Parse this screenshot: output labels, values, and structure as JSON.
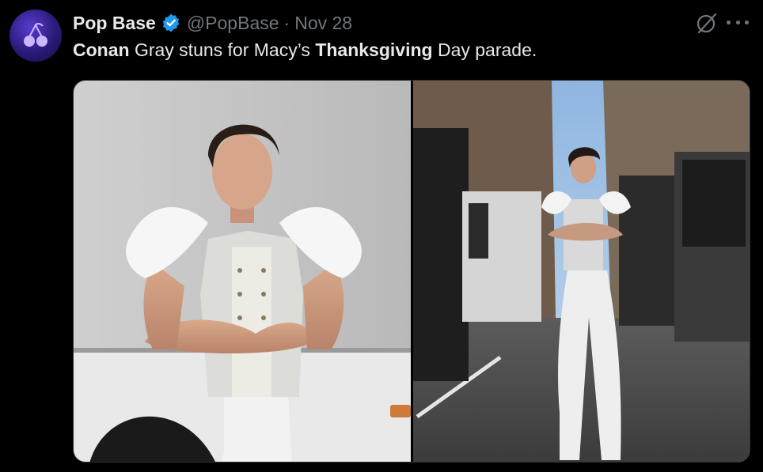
{
  "tweet": {
    "author_name": "Pop Base",
    "handle": "@PopBase",
    "separator": "·",
    "date": "Nov 28",
    "text_parts": [
      "Conan",
      " Gray stuns for Macy’s ",
      "Thanksgiving",
      " Day parade."
    ]
  },
  "icons": {
    "avatar": "cherry-logo-icon",
    "verified": "verified-badge-icon",
    "grok": "grok-icon",
    "more": "more-options-icon"
  },
  "colors": {
    "background": "#000000",
    "primary_text": "#e7e9ea",
    "secondary_text": "#71767b",
    "verified_blue": "#1d9bf0"
  },
  "media": {
    "photos": [
      "photo-left",
      "photo-right"
    ]
  }
}
